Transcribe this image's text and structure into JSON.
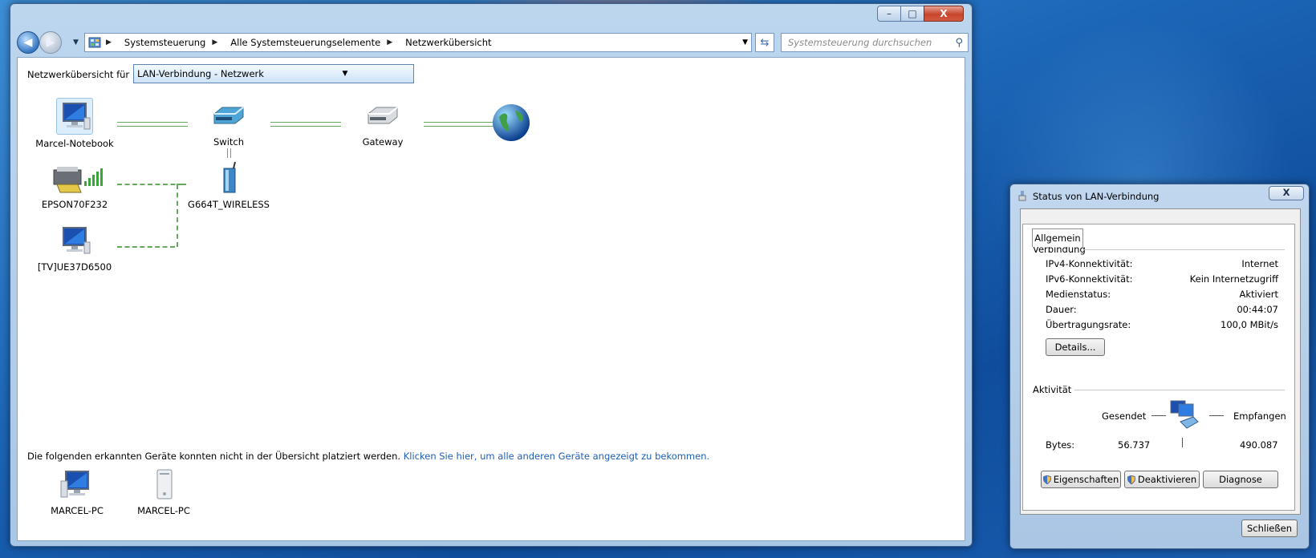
{
  "explorer": {
    "window_controls": {
      "minimize": "–",
      "maximize": "□",
      "close": "X"
    },
    "breadcrumb": [
      "Systemsteuerung",
      "Alle Systemsteuerungselemente",
      "Netzwerkübersicht"
    ],
    "search_placeholder": "Systemsteuerung durchsuchen",
    "network_for_label": "Netzwerkübersicht für",
    "network_selected": "LAN-Verbindung - Netzwerk",
    "nodes": {
      "computer": "Marcel-Notebook",
      "switch": "Switch",
      "gateway": "Gateway",
      "printer": "EPSON70F232",
      "wireless": "G664T_WIRELESS",
      "tv": "[TV]UE37D6500"
    },
    "footnote_text": "Die folgenden erkannten Geräte konnten nicht in der Übersicht platziert werden.",
    "footnote_link": "Klicken Sie hier, um alle anderen Geräte angezeigt zu bekommen.",
    "unplaced": [
      "MARCEL-PC",
      "MARCEL-PC"
    ]
  },
  "status_dialog": {
    "title": "Status von LAN-Verbindung",
    "close": "X",
    "tab": "Allgemein",
    "connection_group": "Verbindung",
    "rows": [
      {
        "label": "IPv4-Konnektivität:",
        "value": "Internet"
      },
      {
        "label": "IPv6-Konnektivität:",
        "value": "Kein Internetzugriff"
      },
      {
        "label": "Medienstatus:",
        "value": "Aktiviert"
      },
      {
        "label": "Dauer:",
        "value": "00:44:07"
      },
      {
        "label": "Übertragungsrate:",
        "value": "100,0 MBit/s"
      }
    ],
    "details_button": "Details...",
    "activity_group": "Aktivität",
    "sent_label": "Gesendet",
    "received_label": "Empfangen",
    "bytes_label": "Bytes:",
    "bytes_sent": "56.737",
    "bytes_received": "490.087",
    "properties_button": "Eigenschaften",
    "deactivate_button": "Deaktivieren",
    "diagnose_button": "Diagnose",
    "close_button": "Schließen"
  }
}
